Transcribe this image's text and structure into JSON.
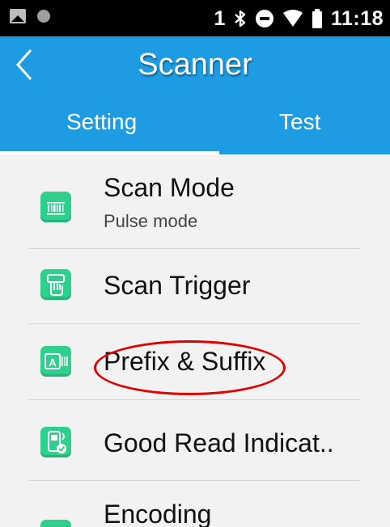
{
  "status_bar": {
    "sim_slot": "1",
    "time": "11:18",
    "icons": [
      "image-notification-icon",
      "dot-notification-icon",
      "bluetooth-icon",
      "do-not-disturb-icon",
      "wifi-icon",
      "battery-icon"
    ]
  },
  "app_bar": {
    "title": "Scanner",
    "back_icon": "chevron-left-icon"
  },
  "tabs": [
    {
      "label": "Setting",
      "selected": true
    },
    {
      "label": "Test",
      "selected": false
    }
  ],
  "list": {
    "items": [
      {
        "title": "Scan Mode",
        "subtitle": "Pulse mode",
        "icon": "barcode-icon"
      },
      {
        "title": "Scan Trigger",
        "icon": "trigger-hand-icon"
      },
      {
        "title": "Prefix & Suffix",
        "icon": "text-affix-icon"
      },
      {
        "title": "Good Read Indicat..",
        "icon": "device-sound-icon"
      },
      {
        "title": "Encoding",
        "icon": "encoding-icon"
      }
    ]
  },
  "annotation": {
    "target": "Prefix & Suffix",
    "color": "#e10000"
  },
  "colors": {
    "accent": "#1d9ce4",
    "status_bar": "#000000",
    "icon_green": "#2fcf8d",
    "list_background": "#f2f2f2"
  }
}
